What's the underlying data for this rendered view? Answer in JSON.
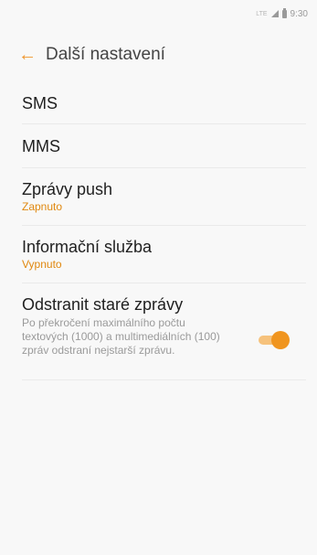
{
  "status_bar": {
    "network": "LTE",
    "time": "9:30"
  },
  "header": {
    "back_icon": "arrow-left-icon",
    "title": "Další nastavení"
  },
  "settings": {
    "sms": {
      "title": "SMS"
    },
    "mms": {
      "title": "MMS"
    },
    "push": {
      "title": "Zprávy push",
      "status": "Zapnuto"
    },
    "cell_broadcast": {
      "title": "Informační služba",
      "status": "Vypnuto"
    },
    "delete_old": {
      "title": "Odstranit staré zprávy",
      "description": "Po překročení maximálního počtu textových (1000) a multimediálních (100) zpráv odstraní nejstarší zprávu.",
      "toggle_on": true
    }
  },
  "colors": {
    "accent": "#f0952b",
    "status_text": "#e0880f",
    "toggle_thumb": "#f0951f",
    "toggle_track": "#f6c27c"
  }
}
